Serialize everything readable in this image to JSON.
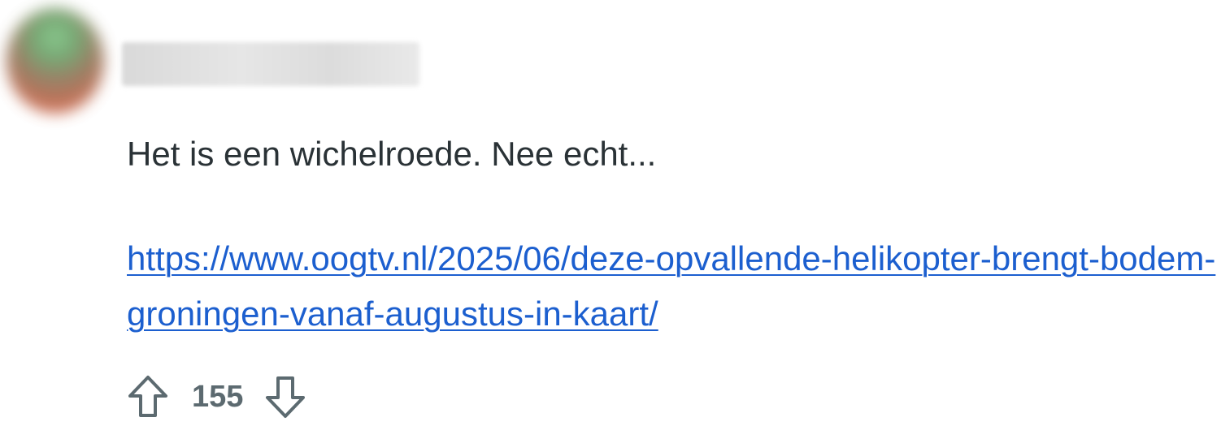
{
  "comment": {
    "author": {
      "username": "",
      "avatar_icon": "user-avatar-blurred"
    },
    "body_text": "Het is een wichelroede. Nee echt...",
    "link_text": "https://www.oogtv.nl/2025/06/deze-opvallende-helikopter-brengt-bodem-groningen-vanaf-augustus-in-kaart/",
    "votes": {
      "score": "155",
      "upvote_icon": "arrow-up-outline-icon",
      "downvote_icon": "arrow-down-outline-icon"
    }
  },
  "colors": {
    "text": "#2a3236",
    "link": "#1c5fcf",
    "meta": "#5c6a70"
  }
}
